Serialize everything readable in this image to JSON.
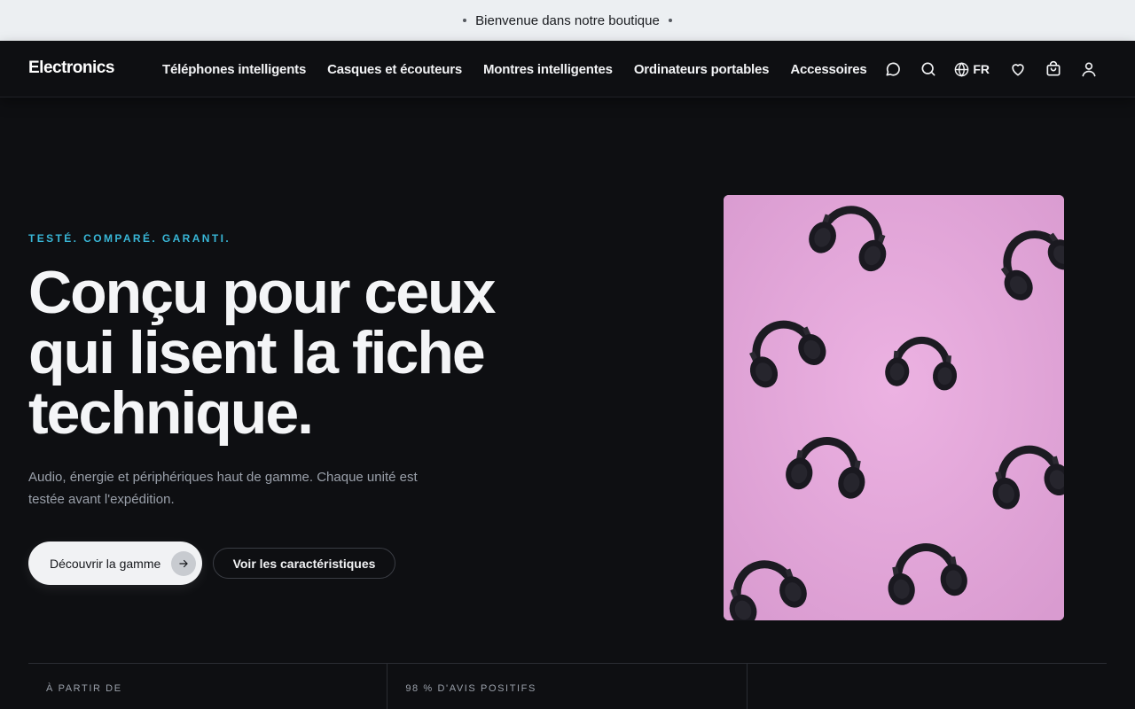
{
  "announcement": {
    "text": "Bienvenue dans notre boutique"
  },
  "nav": {
    "brand": "Electronics",
    "links": [
      "Téléphones intelligents",
      "Casques et écouteurs",
      "Montres intelligentes",
      "Ordinateurs portables",
      "Accessoires"
    ],
    "language": "FR",
    "icons": [
      "chat-icon",
      "search-icon",
      "globe-icon",
      "heart-icon",
      "shopping-bag-icon",
      "user-icon"
    ]
  },
  "hero": {
    "eyebrow": "TESTÉ. COMPARÉ. GARANTI.",
    "headline": "Conçu pour ceux qui lisent la fiche technique.",
    "subtitle": "Audio, énergie et périphériques haut de gamme. Chaque unité est testée avant l'expédition.",
    "primary_cta": "Découvrir la gamme",
    "secondary_cta": "Voir les caractéristiques",
    "image_background": "#e3a6d9"
  },
  "stats": [
    {
      "label": "À PARTIR DE"
    },
    {
      "label": "98 % D'AVIS POSITIFS"
    },
    {
      "label": ""
    }
  ],
  "colors": {
    "accent": "#38b6d6",
    "background": "#0e0f12",
    "announcement_bg": "#eceff2"
  }
}
